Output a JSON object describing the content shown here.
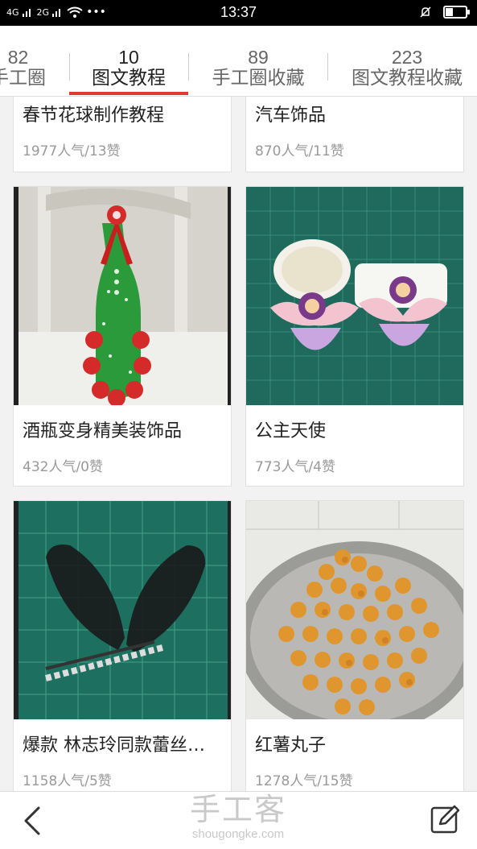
{
  "status_bar": {
    "signal_1": "4G",
    "signal_2": "2G",
    "dots": "•••",
    "time": "13:37"
  },
  "tabs": [
    {
      "count": "82",
      "label": "手工圈",
      "active": false
    },
    {
      "count": "10",
      "label": "图文教程",
      "active": true
    },
    {
      "count": "89",
      "label": "手工圈收藏",
      "active": false
    },
    {
      "count": "223",
      "label": "图文教程收藏",
      "active": false
    }
  ],
  "cards": [
    {
      "title": "春节花球制作教程",
      "meta": "1977人气/13赞"
    },
    {
      "title": "汽车饰品",
      "meta": "870人气/11赞"
    },
    {
      "title": "酒瓶变身精美装饰品",
      "meta": "432人气/0赞",
      "image": "green-bottle-decoration"
    },
    {
      "title": "公主天使",
      "meta": "773人气/4赞",
      "image": "princess-angel-crafts"
    },
    {
      "title": "爆款 林志玲同款蕾丝…",
      "meta": "1158人气/5赞",
      "image": "lace-bunny-ear-hairpin"
    },
    {
      "title": "红薯丸子",
      "meta": "1278人气/15赞",
      "image": "sweet-potato-balls"
    }
  ],
  "watermark": {
    "cn": "手工客",
    "en": "shougongke.com"
  },
  "bottom_bar": {
    "back_icon": "chevron-left-icon",
    "edit_icon": "edit-icon"
  },
  "colors": {
    "accent": "#e0392d",
    "title": "#222222",
    "meta": "#999999"
  }
}
